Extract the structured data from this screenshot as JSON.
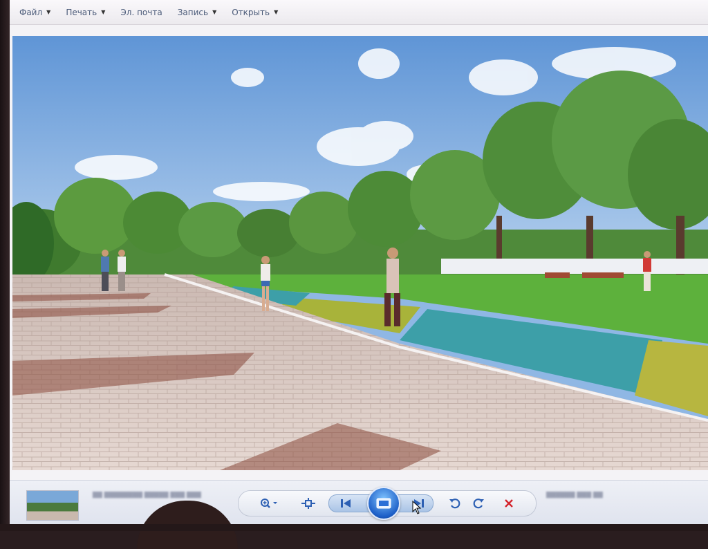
{
  "menu": {
    "items": [
      {
        "label": "Файл"
      },
      {
        "label": "Печать"
      },
      {
        "label": "Эл. почта"
      },
      {
        "label": "Запись"
      },
      {
        "label": "Открыть"
      }
    ]
  },
  "viewer": {
    "image_description_icon": "park-rendering-image"
  },
  "controls": {
    "zoom_icon": "zoom-icon",
    "fit_icon": "actual-size-icon",
    "prev_icon": "previous-icon",
    "slideshow_icon": "slideshow-icon",
    "next_icon": "next-icon",
    "rotate_left_icon": "rotate-left-icon",
    "rotate_right_icon": "rotate-right-icon",
    "delete_icon": "delete-icon"
  },
  "colors": {
    "accent": "#2c5fb3",
    "delete": "#d4232b",
    "menu_text": "#4a5a78"
  }
}
